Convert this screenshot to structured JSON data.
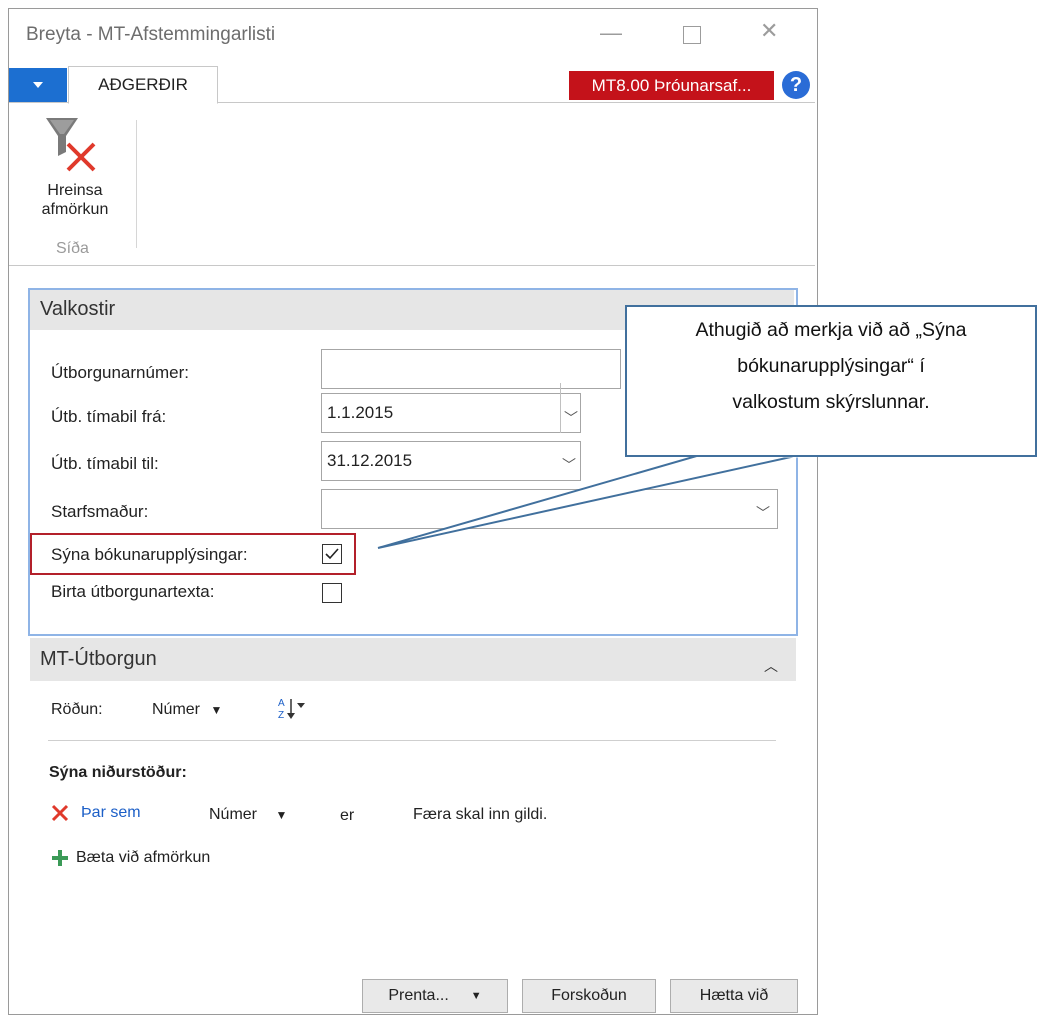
{
  "window": {
    "title": "Breyta - MT-Afstemmingarlisti"
  },
  "ribbon": {
    "tab_actions": "AÐGERÐIR",
    "environment_badge": "MT8.00 Þróunarsaf...",
    "help": "?",
    "clear_filter_line1": "Hreinsa",
    "clear_filter_line2": "afmörkun",
    "group_label": "Síða"
  },
  "options": {
    "title": "Valkostir",
    "fields": {
      "payment_number": {
        "label": "Útborgunarnúmer:",
        "value": ""
      },
      "period_from": {
        "label": "Útb. tímabil frá:",
        "value": "1.1.2015"
      },
      "period_to": {
        "label": "Útb. tímabil til:",
        "value": "31.12.2015"
      },
      "employee": {
        "label": "Starfsmaður:",
        "value": ""
      },
      "show_posting": {
        "label": "Sýna bókunarupplýsingar:",
        "checked": true
      },
      "show_text": {
        "label": "Birta útborgunartexta:",
        "checked": false
      }
    }
  },
  "payment": {
    "title": "MT-Útborgun",
    "sort_label": "Röðun:",
    "sort_value": "Númer",
    "show_results": "Sýna niðurstöður:",
    "filter": {
      "where": "Þar sem",
      "field": "Númer",
      "operator": "er",
      "value": "Færa skal inn gildi."
    },
    "add_filter": "Bæta við afmörkun"
  },
  "buttons": {
    "print": "Prenta...",
    "preview": "Forskoðun",
    "cancel": "Hætta við"
  },
  "callout": {
    "line1": "Athugið að merkja við að „Sýna",
    "line2": "bókunarupplýsingar“ í",
    "line3": "valkostum skýrslunnar."
  },
  "colors": {
    "accent": "#1c6fd1",
    "badge": "#c4121a",
    "highlight": "#b3202a",
    "callout_border": "#41709d"
  }
}
